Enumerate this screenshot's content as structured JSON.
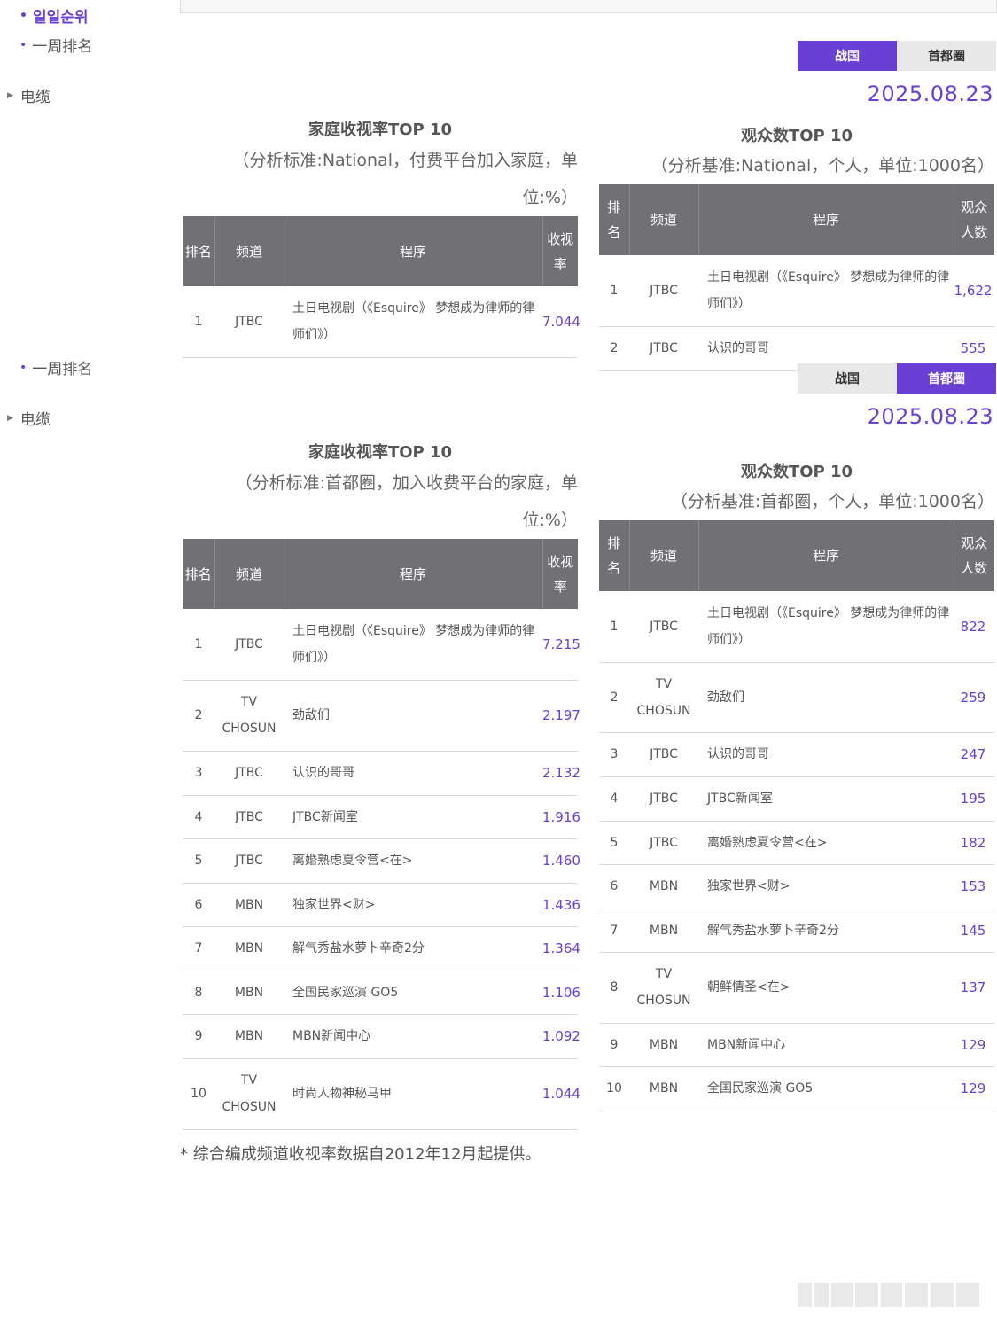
{
  "nav": {
    "daily_rank": "일일순위",
    "weekly_rank": "一周排名",
    "cable": "电缆"
  },
  "tabs": {
    "national": "战国",
    "capital": "首都圈"
  },
  "date": "2025.08.23",
  "national": {
    "household": {
      "title": "家庭收视率TOP 10",
      "subtitle_line1": "（分析标准:National，付费平台加入家庭，单",
      "subtitle_line2": "位:%）",
      "headers": [
        "排名",
        "频道",
        "程序",
        "收视率"
      ],
      "rows": [
        {
          "rank": "1",
          "channel": "JTBC",
          "program": "土日电视剧（《Esquire》 梦想成为律师的律师们》）",
          "value": "7.044"
        }
      ]
    },
    "viewers": {
      "title": "观众数TOP 10",
      "subtitle": "（分析基准:National，个人，单位:1000名）",
      "headers": [
        "排名",
        "频道",
        "程序",
        "观众人数"
      ],
      "rows": [
        {
          "rank": "1",
          "channel": "JTBC",
          "program": "土日电视剧（《Esquire》 梦想成为律师的律师们》）",
          "value": "1,622"
        },
        {
          "rank": "2",
          "channel": "JTBC",
          "program": "认识的哥哥",
          "value": "555"
        }
      ]
    }
  },
  "capital": {
    "household": {
      "title": "家庭收视率TOP 10",
      "subtitle_line1": "（分析标准:首都圈，加入收费平台的家庭，单",
      "subtitle_line2": "位:%）",
      "headers": [
        "排名",
        "频道",
        "程序",
        "收视率"
      ],
      "rows": [
        {
          "rank": "1",
          "channel": "JTBC",
          "program": "土日电视剧（《Esquire》 梦想成为律师的律师们》）",
          "value": "7.215"
        },
        {
          "rank": "2",
          "channel": "TV CHOSUN",
          "program": "劲敌们",
          "value": "2.197"
        },
        {
          "rank": "3",
          "channel": "JTBC",
          "program": "认识的哥哥",
          "value": "2.132"
        },
        {
          "rank": "4",
          "channel": "JTBC",
          "program": "JTBC新闻室",
          "value": "1.916"
        },
        {
          "rank": "5",
          "channel": "JTBC",
          "program": "离婚熟虑夏令营<在>",
          "value": "1.460"
        },
        {
          "rank": "6",
          "channel": "MBN",
          "program": "独家世界<财>",
          "value": "1.436"
        },
        {
          "rank": "7",
          "channel": "MBN",
          "program": "解气秀盐水萝卜辛奇2分",
          "value": "1.364"
        },
        {
          "rank": "8",
          "channel": "MBN",
          "program": "全国民家巡演 GO5",
          "value": "1.106"
        },
        {
          "rank": "9",
          "channel": "MBN",
          "program": "MBN新闻中心",
          "value": "1.092"
        },
        {
          "rank": "10",
          "channel": "TV CHOSUN",
          "program": "时尚人物神秘马甲",
          "value": "1.044"
        }
      ]
    },
    "viewers": {
      "title": "观众数TOP 10",
      "subtitle": "（分析基准:首都圈，个人，单位:1000名）",
      "headers": [
        "排名",
        "频道",
        "程序",
        "观众人数"
      ],
      "rows": [
        {
          "rank": "1",
          "channel": "JTBC",
          "program": "土日电视剧（《Esquire》 梦想成为律师的律师们》）",
          "value": "822"
        },
        {
          "rank": "2",
          "channel": "TV CHOSUN",
          "program": "劲敌们",
          "value": "259"
        },
        {
          "rank": "3",
          "channel": "JTBC",
          "program": "认识的哥哥",
          "value": "247"
        },
        {
          "rank": "4",
          "channel": "JTBC",
          "program": "JTBC新闻室",
          "value": "195"
        },
        {
          "rank": "5",
          "channel": "JTBC",
          "program": "离婚熟虑夏令营<在>",
          "value": "182"
        },
        {
          "rank": "6",
          "channel": "MBN",
          "program": "独家世界<财>",
          "value": "153"
        },
        {
          "rank": "7",
          "channel": "MBN",
          "program": "解气秀盐水萝卜辛奇2分",
          "value": "145"
        },
        {
          "rank": "8",
          "channel": "TV CHOSUN",
          "program": "朝鲜情圣<在>",
          "value": "137"
        },
        {
          "rank": "9",
          "channel": "MBN",
          "program": "MBN新闻中心",
          "value": "129"
        },
        {
          "rank": "10",
          "channel": "MBN",
          "program": "全国民家巡演 GO5",
          "value": "129"
        }
      ]
    }
  },
  "footnote": "* 综合编成频道收视率数据自2012年12月起提供。",
  "colors": {
    "accent": "#6a3fd6",
    "header_bg": "#717175",
    "tab_off": "#e8e8e8"
  }
}
